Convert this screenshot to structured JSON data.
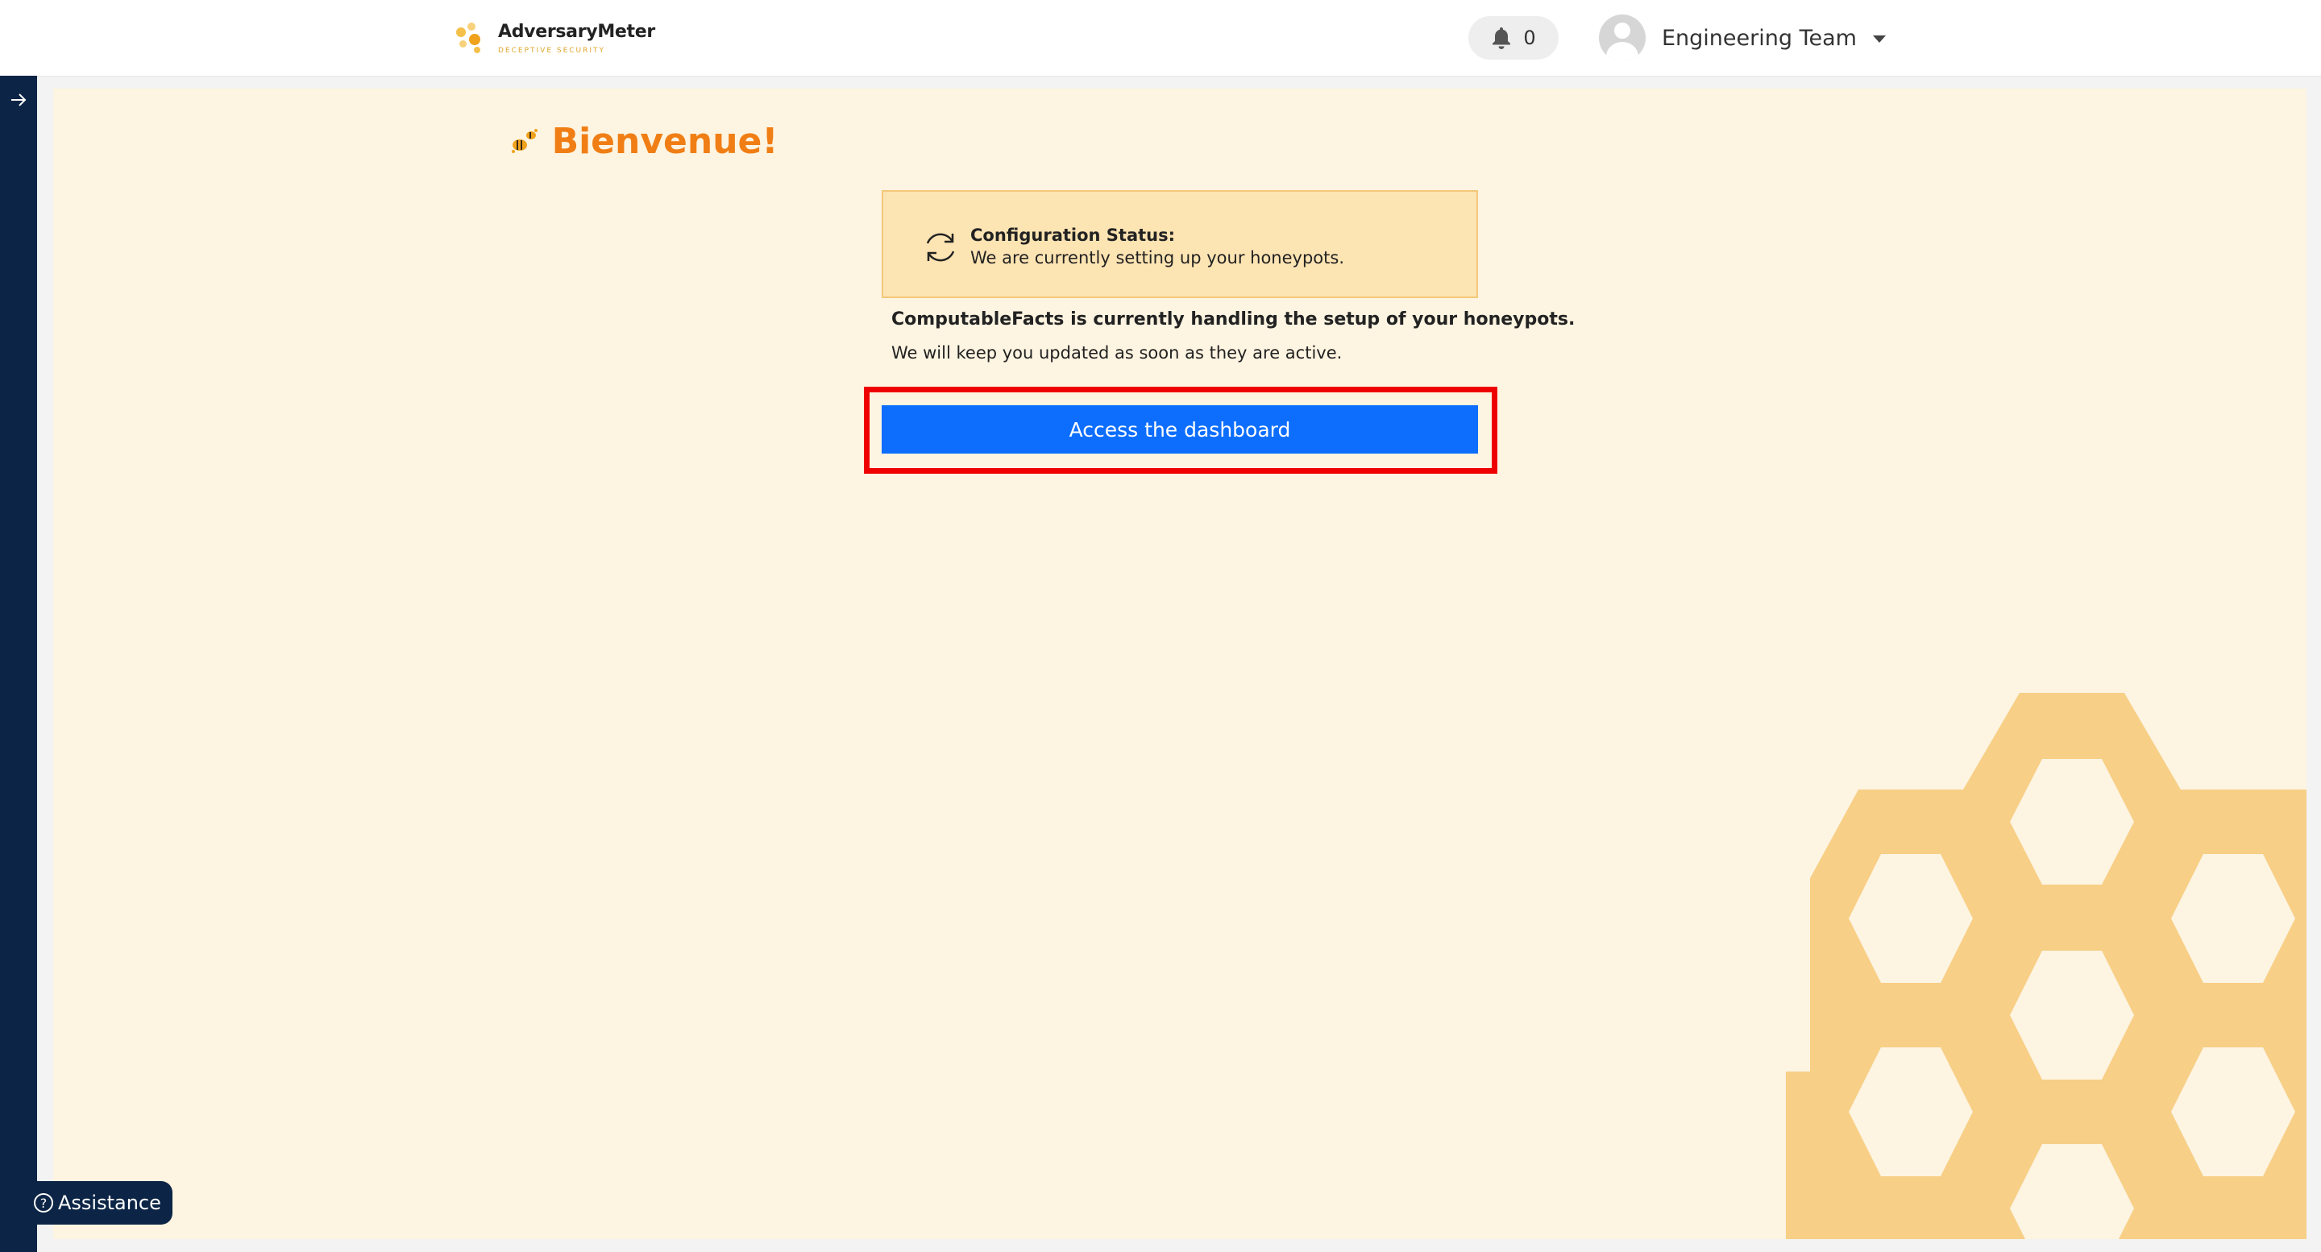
{
  "header": {
    "logo_title": "AdversaryMeter",
    "logo_subtitle": "DECEPTIVE SECURITY",
    "notifications_count": "0",
    "user_name": "Engineering Team"
  },
  "main": {
    "welcome_title": "Bienvenue!",
    "status_label": "Configuration Status:",
    "status_message": "We are currently setting up your honeypots.",
    "handling_text": "ComputableFacts is currently handling the setup of your honeypots.",
    "update_text": "We will keep you updated as soon as they are active.",
    "dashboard_button": "Access the dashboard"
  },
  "assistance": {
    "label": "Assistance"
  },
  "colors": {
    "accent_orange": "#f07e14",
    "primary_blue": "#0d6efd",
    "sidebar_navy": "#0c2546",
    "highlight_red": "#ee0000",
    "hex_pattern": "#f7cf86"
  },
  "icons": {
    "logo": "honeycomb-logo-icon",
    "notification": "bell-icon",
    "user": "user-avatar-icon",
    "dropdown": "chevron-down-icon",
    "sidebar_toggle": "arrow-right-icon",
    "welcome": "bees-icon",
    "status": "sync-icon",
    "assistance": "question-circle-icon"
  }
}
